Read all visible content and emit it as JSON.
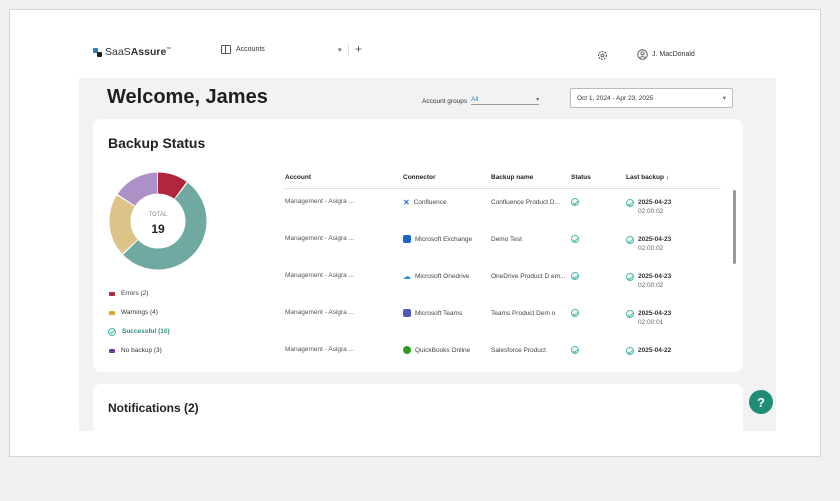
{
  "app": {
    "logo_prefix": "SaaS",
    "logo_bold": "Assure",
    "logo_tm": "™",
    "tab_label": "Accounts",
    "user_name": "J. MacDonald"
  },
  "header": {
    "welcome": "Welcome, James",
    "groups_label": "Account groups",
    "groups_value": "All",
    "date_range": "Oct 1, 2024 - Apr 23, 2025"
  },
  "backup": {
    "title": "Backup Status",
    "donut_label": "TOTAL",
    "donut_total": "19",
    "legend": [
      {
        "label": "Errors (2)",
        "color": "#b0273d"
      },
      {
        "label": "Warnings (4)",
        "color": "#d9a928"
      },
      {
        "label": "Successful (10)",
        "color": "#5fa49c"
      },
      {
        "label": "No backup (3)",
        "color": "#6b3fa0"
      }
    ],
    "table_headers": [
      "Account",
      "Connector",
      "Backup name",
      "Status",
      "Last backup ↓"
    ],
    "rows": [
      {
        "account": "Management - Asigra ...",
        "connector": "Confluence",
        "connector_color": "#2b6fd1",
        "backup": "Confluence Product D...",
        "last_date": "2025-04-23",
        "last_time": "02:00:02"
      },
      {
        "account": "Management - Asigra ...",
        "connector": "Microsoft Exchange",
        "connector_color": "#1e65c8",
        "backup": "Demo Test",
        "last_date": "2025-04-23",
        "last_time": "02:00:02"
      },
      {
        "account": "Management - Asigra ...",
        "connector": "Microsoft Onedrive",
        "connector_color": "#2a8fe3",
        "backup": "OneDrive Product D em...",
        "last_date": "2025-04-23",
        "last_time": "02:00:02"
      },
      {
        "account": "Management - Asigra ...",
        "connector": "Microsoft Teams",
        "connector_color": "#5358b8",
        "backup": "Teams Product Dem o",
        "last_date": "2025-04-23",
        "last_time": "02:00:01"
      },
      {
        "account": "Management - Asigra ...",
        "connector": "QuickBooks Online",
        "connector_color": "#2ca01c",
        "backup": "Salesforce Product",
        "last_date": "2025-04-22",
        "last_time": ""
      }
    ],
    "donut_segments": [
      {
        "name": "Errors",
        "value": 2,
        "color": "#b0273d"
      },
      {
        "name": "Successful",
        "value": 10,
        "color": "#6fa9a1"
      },
      {
        "name": "Warnings",
        "value": 4,
        "color": "#dcc389"
      },
      {
        "name": "No backup",
        "value": 3,
        "color": "#ae90c8"
      }
    ]
  },
  "notifications": {
    "title": "Notifications (2)"
  },
  "help_label": "?"
}
